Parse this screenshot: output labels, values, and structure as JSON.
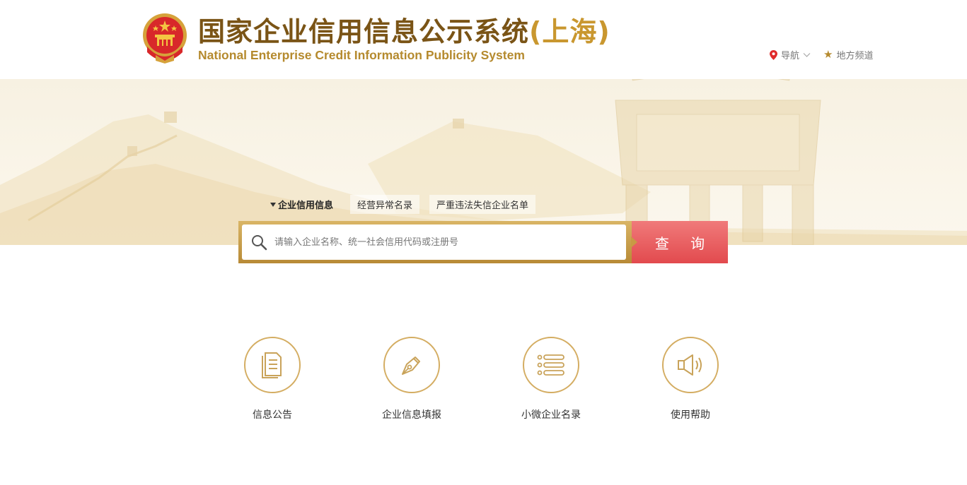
{
  "header": {
    "title_cn": "国家企业信用信息公示系统",
    "title_region": "(上海)",
    "title_en": "National Enterprise Credit Information Publicity System"
  },
  "topnav": {
    "navigation_label": "导航",
    "local_channel_label": "地方频道"
  },
  "search": {
    "tabs": [
      {
        "label": "企业信用信息",
        "active": true
      },
      {
        "label": "经营异常名录",
        "active": false
      },
      {
        "label": "严重违法失信企业名单",
        "active": false
      }
    ],
    "placeholder": "请输入企业名称、统一社会信用代码或注册号",
    "button_label": "查 询"
  },
  "features": [
    {
      "label": "信息公告",
      "icon": "document-icon"
    },
    {
      "label": "企业信息填报",
      "icon": "pen-icon"
    },
    {
      "label": "小微企业名录",
      "icon": "list-icon"
    },
    {
      "label": "使用帮助",
      "icon": "speaker-icon"
    }
  ],
  "colors": {
    "gold": "#b58a2e",
    "brown": "#7a5416",
    "search_button": "#e24a4e",
    "banner_bg": "#f7f1e2"
  }
}
